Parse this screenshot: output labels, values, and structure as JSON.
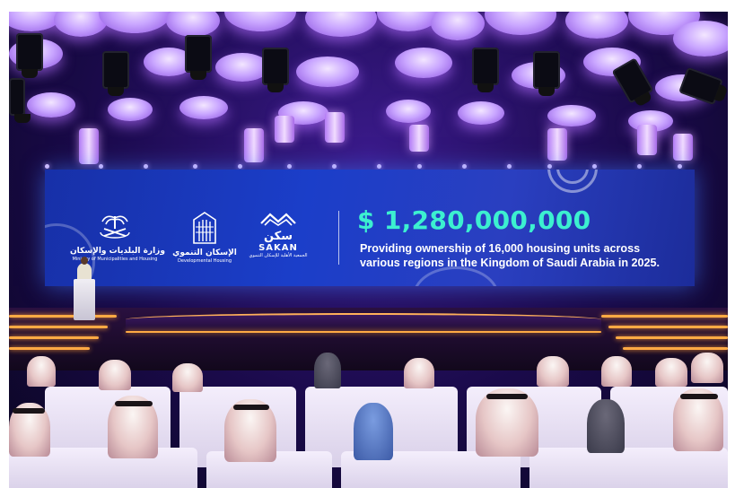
{
  "screen": {
    "amount": "$ 1,280,000,000",
    "description_line1": "Providing ownership of 16,000 housing units across",
    "description_line2": "various regions in the Kingdom of Saudi Arabia in 2025.",
    "logos": {
      "ministry_ar": "وزارة البلديات والإسكان",
      "ministry_en": "Ministry of Municipalities and Housing",
      "developmental_ar": "الإسكان التنموي",
      "developmental_en": "Developmental Housing",
      "sakan_ar": "سكن",
      "sakan_en": "SAKAN",
      "sakan_tagline_ar": "الجمعية الأهلية للإسكان التنموي"
    }
  },
  "colors": {
    "amount": "#3cf0d0",
    "screen": "#1b3ec9",
    "ambient": "#3a1a8a",
    "stage_edge": "#ffaa44"
  },
  "icons": {
    "ministry_logo": "palm-and-swords-emblem-icon",
    "developmental_logo": "building-emblem-icon",
    "sakan_logo": "roof-waves-icon"
  }
}
